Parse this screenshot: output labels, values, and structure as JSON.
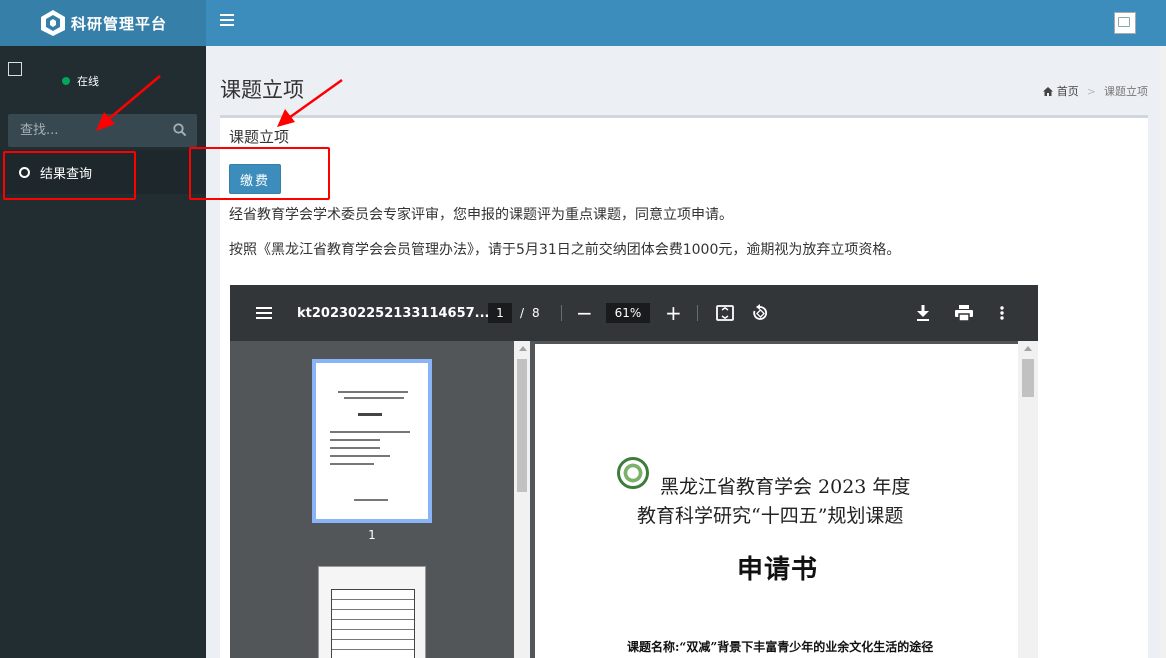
{
  "app": {
    "title": "科研管理平台"
  },
  "sidebar": {
    "status": "在线",
    "search_placeholder": "查找...",
    "items": [
      {
        "label": "结果查询"
      }
    ]
  },
  "header": {
    "page_title": "课题立项",
    "breadcrumb": [
      "首页",
      "课题立项"
    ]
  },
  "content": {
    "box_title": "课题立项",
    "pay_button": "缴费",
    "notice1": "经省教育学会学术委员会专家评审，您申报的课题评为重点课题，同意立项申请。",
    "notice2": "按照《黑龙江省教育学会会员管理办法》，请于5月31日之前交纳团体会费1000元，逾期视为放弃立项资格。"
  },
  "pdf_viewer": {
    "filename": "kt20230225213311465​7...",
    "current_page": "1",
    "page_sep": "/",
    "total_pages": "8",
    "zoom": "61%",
    "zoom_minus": "−",
    "zoom_plus": "+",
    "thumbnail_label": "1",
    "doc": {
      "line1": "黑龙江省教育学会 2023 年度",
      "line2": "教育科学研究“十四五”规划课题",
      "title": "申请书",
      "subject": "课题名称:“双减”背景下丰富青少年的业余文化生活的途径"
    }
  },
  "colors": {
    "topbar": "#3c8dbc",
    "logo_bar": "#367fa9",
    "sidebar": "#222d32",
    "annotation": "#ff0000"
  }
}
